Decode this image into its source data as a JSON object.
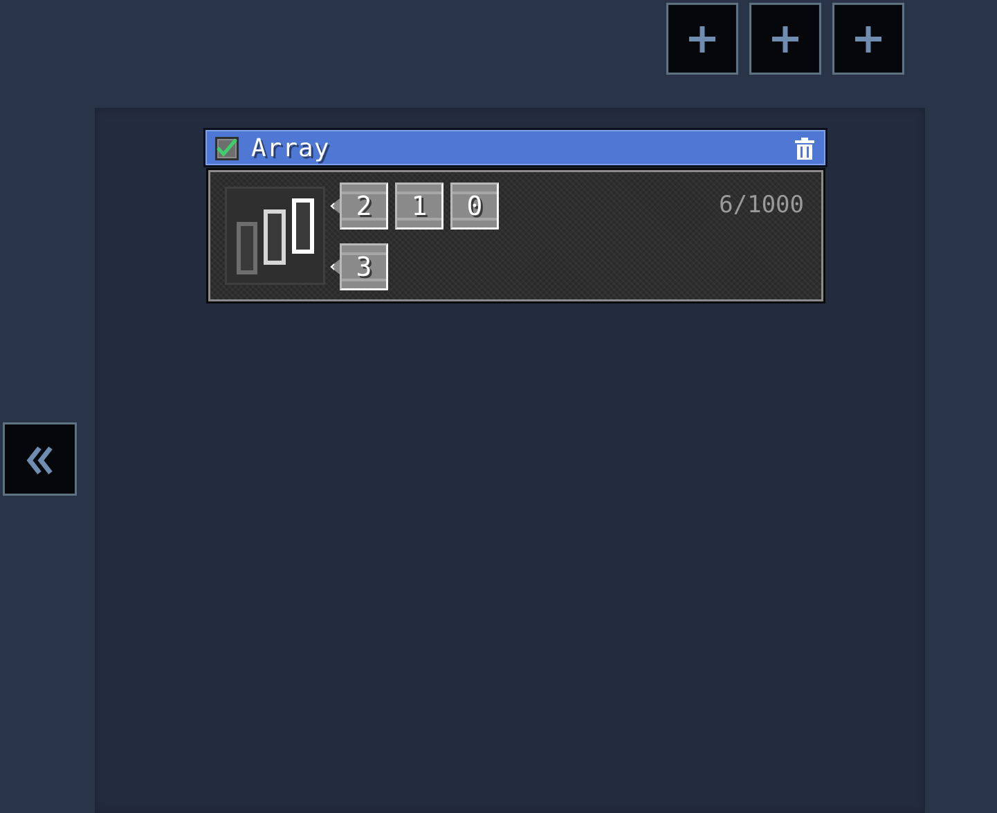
{
  "toolbar": {
    "add_buttons": [
      {
        "icon": "plus-icon"
      },
      {
        "icon": "plus-icon"
      },
      {
        "icon": "plus-icon"
      }
    ]
  },
  "sidebar": {
    "collapse_icon": "double-chevron-left-icon"
  },
  "node": {
    "title": "Array",
    "enabled": true,
    "delete_icon": "trash-icon",
    "type_icon": "bars-icon",
    "counter": "6/1000",
    "rows": [
      [
        "2",
        "1",
        "0"
      ],
      [
        "3"
      ]
    ]
  },
  "colors": {
    "background": "#293449",
    "panel": "#232c3e",
    "header": "#4e78d4",
    "check": "#3ecf6a",
    "button_border": "#5e7282",
    "plus": "#6f8db0"
  }
}
